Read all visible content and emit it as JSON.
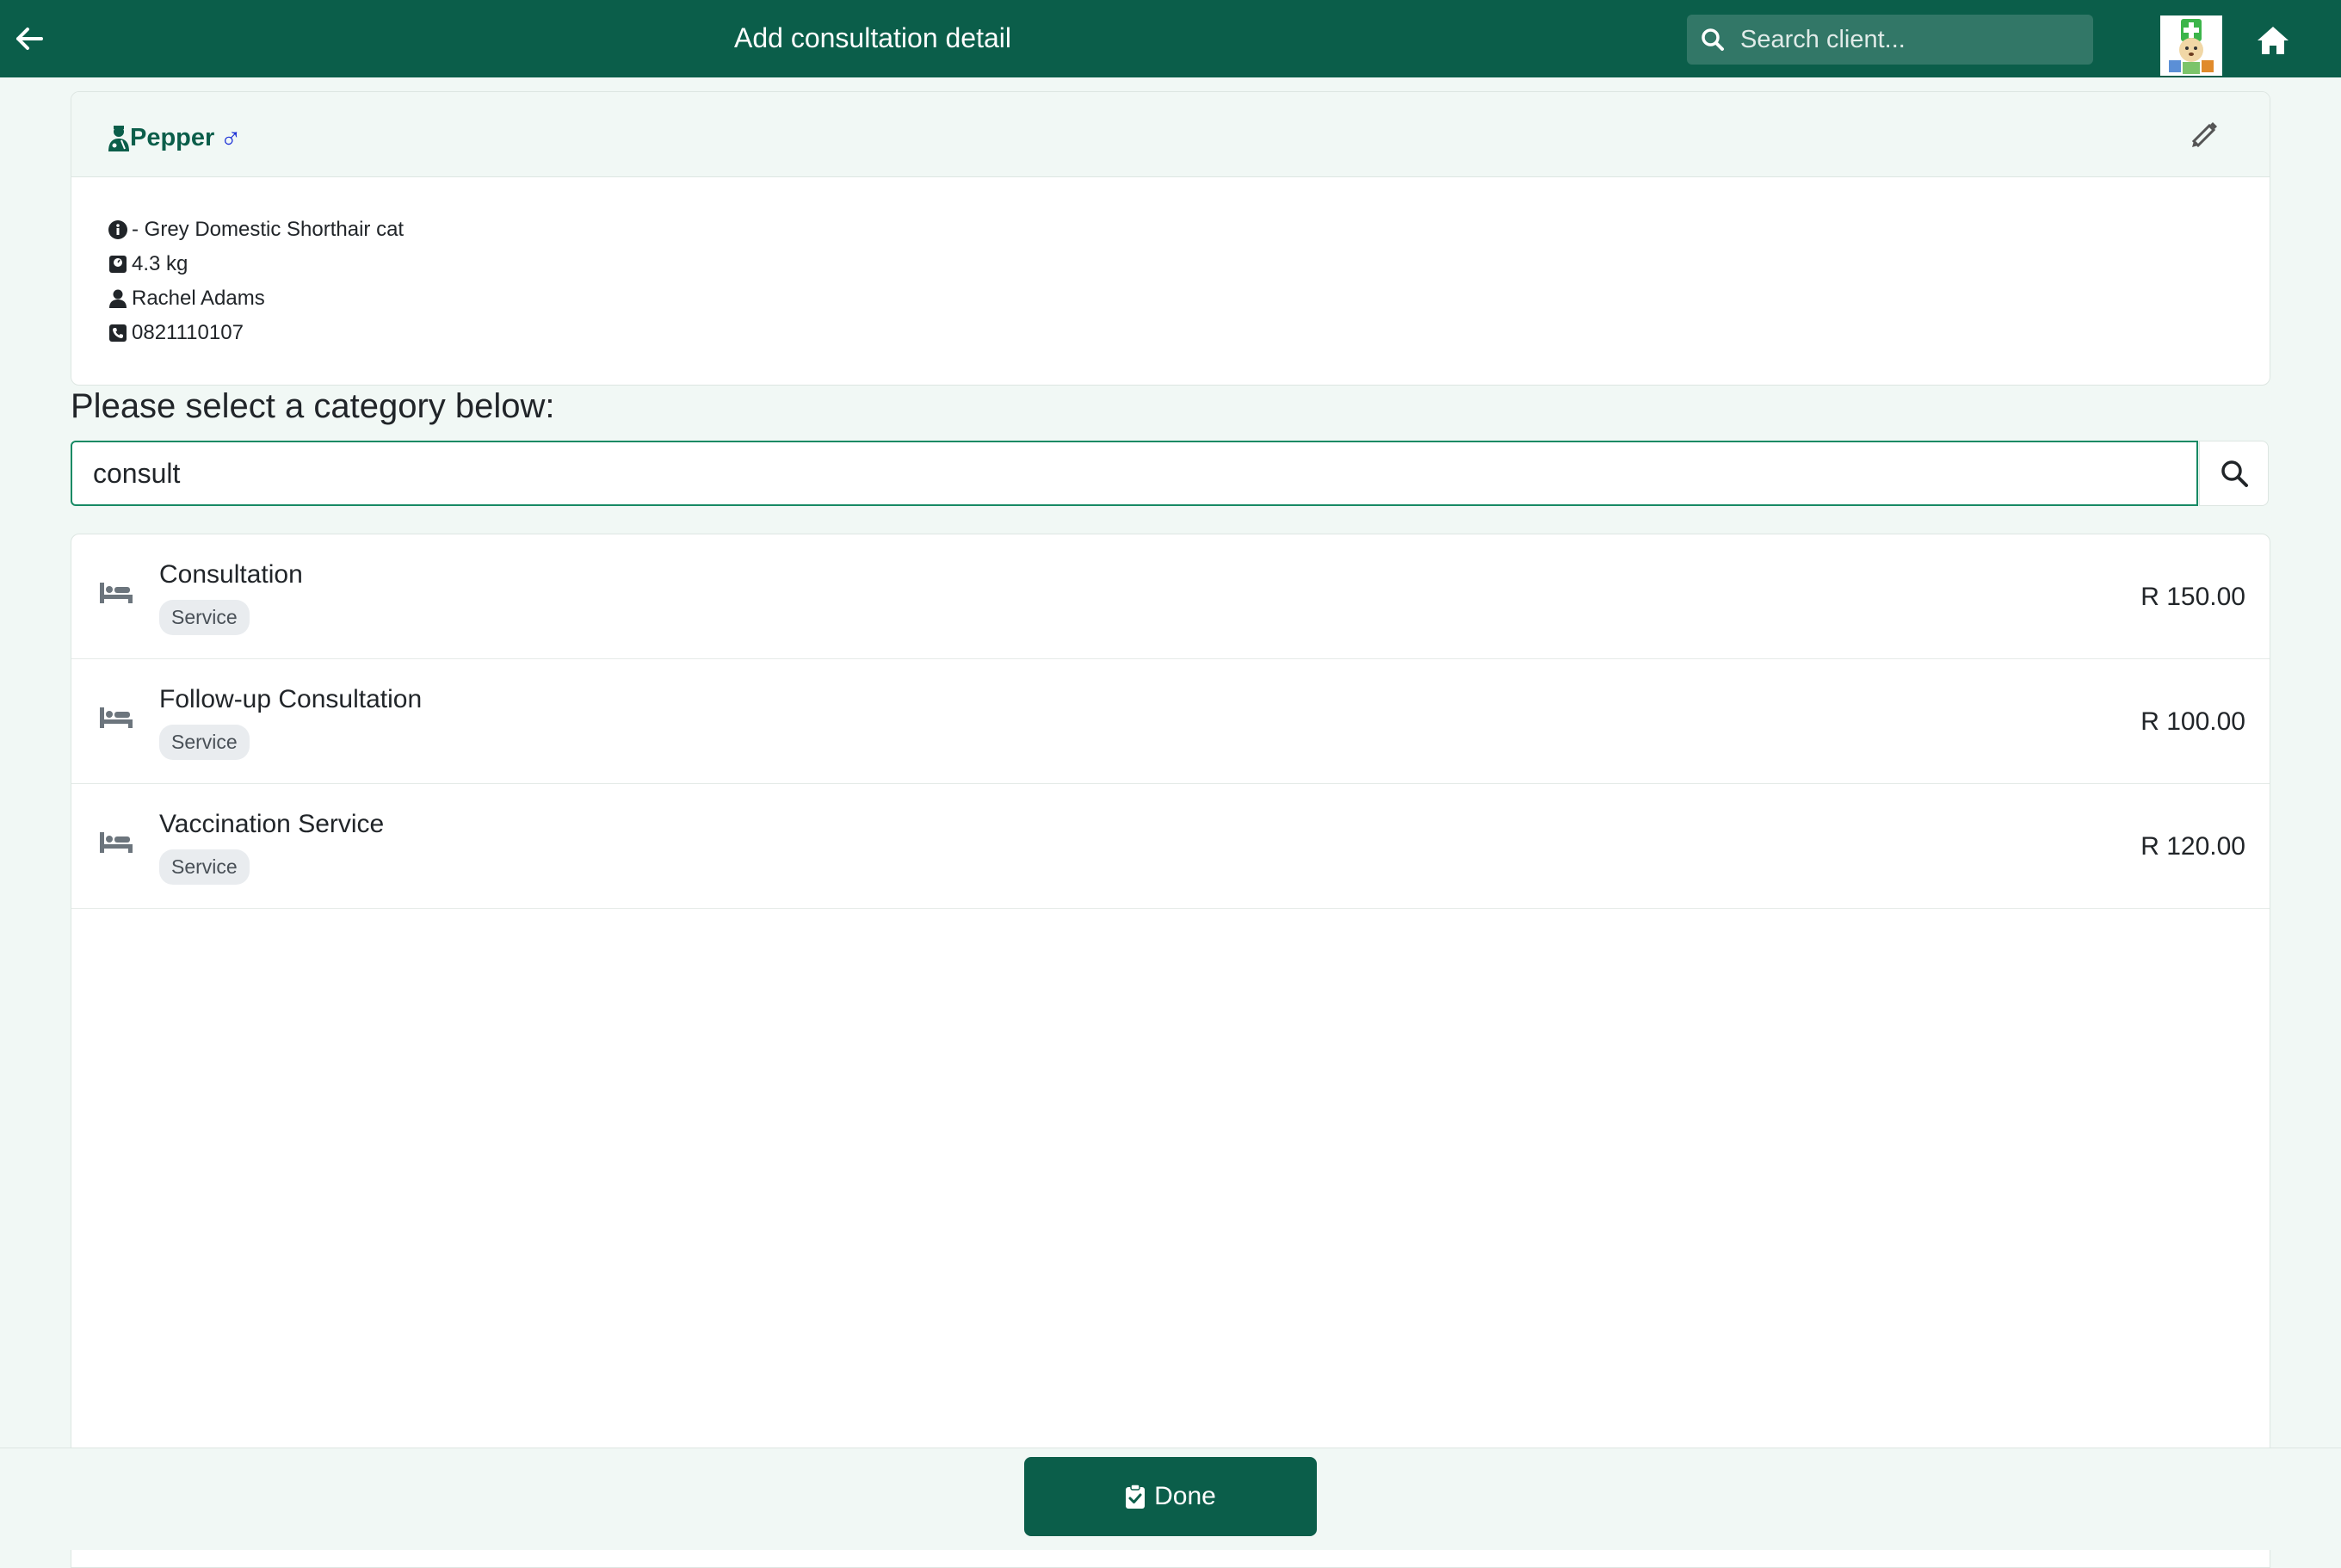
{
  "header": {
    "title": "Add consultation detail",
    "search_placeholder": "Search client..."
  },
  "patient": {
    "name": "Pepper",
    "sex_symbol": "♂",
    "description": "- Grey Domestic Shorthair cat",
    "weight": "4.3 kg",
    "owner": "Rachel Adams",
    "phone": "0821110107"
  },
  "category": {
    "prompt": "Please select a category below:",
    "filter_value": "consult"
  },
  "results": [
    {
      "name": "Consultation",
      "tag": "Service",
      "price": "R 150.00"
    },
    {
      "name": "Follow-up Consultation",
      "tag": "Service",
      "price": "R 100.00"
    },
    {
      "name": "Vaccination Service",
      "tag": "Service",
      "price": "R 120.00"
    }
  ],
  "footer": {
    "done_label": "Done"
  },
  "colors": {
    "brand": "#0b5e4a",
    "page_bg": "#f1f8f5",
    "male_symbol": "#1a2fd6"
  }
}
